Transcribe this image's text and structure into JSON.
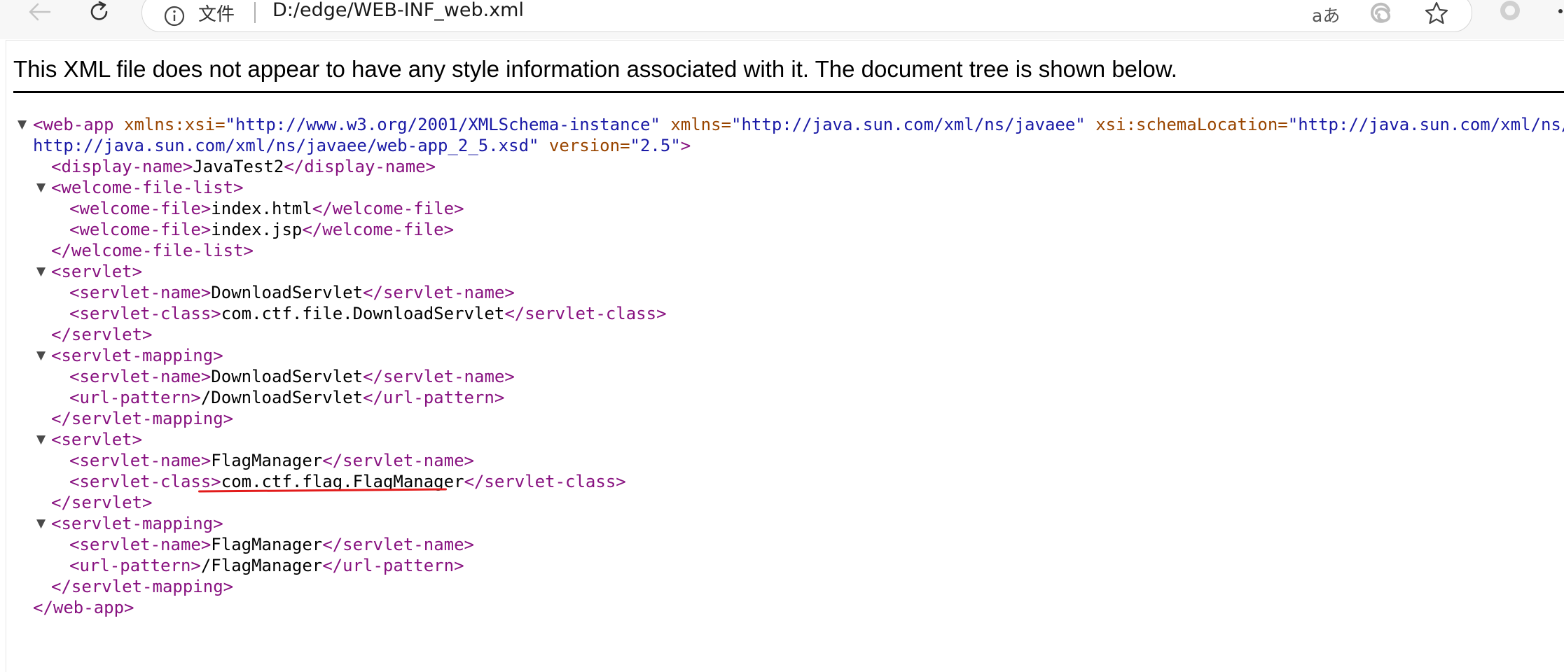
{
  "browser": {
    "address_bar": {
      "site_label": "文件",
      "url": "D:/edge/WEB-INF_web.xml"
    },
    "read_aloud_label": "aあ",
    "icons": {
      "back": "arrow-left-icon",
      "refresh": "refresh-icon",
      "info": "info-icon",
      "read_aloud": "read-aloud-icon",
      "extension": "edge-extension-icon",
      "favorite": "star-icon",
      "profile": "profile-icon",
      "more": "more-icon"
    }
  },
  "notice": "This XML file does not appear to have any style information associated with it. The document tree is shown below.",
  "xml": {
    "root_open": {
      "tag_start": "<web-app",
      "a1_name": " xmlns:xsi=",
      "a1_value": "\"http://www.w3.org/2001/XMLSchema-instance\"",
      "a2_name": " xmlns=",
      "a2_value": "\"http://java.sun.com/xml/ns/javaee\"",
      "a3_name": " xsi:schemaLocation=",
      "a3_value_part1": "\"http://java.sun.com/xml/ns/javaee",
      "a3_value_part2": "http://java.sun.com/xml/ns/javaee/web-app_2_5.xsd\"",
      "a4_name": " version=",
      "a4_value": "\"2.5\"",
      "tag_end": ">"
    },
    "display_name": {
      "open": "<display-name>",
      "text": "JavaTest2",
      "close": "</display-name>"
    },
    "welcome_file_list": {
      "open": "<welcome-file-list>",
      "files": [
        {
          "open": "<welcome-file>",
          "text": "index.html",
          "close": "</welcome-file>"
        },
        {
          "open": "<welcome-file>",
          "text": "index.jsp",
          "close": "</welcome-file>"
        }
      ],
      "close": "</welcome-file-list>"
    },
    "servlet_1": {
      "open": "<servlet>",
      "name": {
        "open": "<servlet-name>",
        "text": "DownloadServlet",
        "close": "</servlet-name>"
      },
      "class": {
        "open": "<servlet-class>",
        "text": "com.ctf.file.DownloadServlet",
        "close": "</servlet-class>"
      },
      "close": "</servlet>"
    },
    "mapping_1": {
      "open": "<servlet-mapping>",
      "name": {
        "open": "<servlet-name>",
        "text": "DownloadServlet",
        "close": "</servlet-name>"
      },
      "pattern": {
        "open": "<url-pattern>",
        "text": "/DownloadServlet",
        "close": "</url-pattern>"
      },
      "close": "</servlet-mapping>"
    },
    "servlet_2": {
      "open": "<servlet>",
      "name": {
        "open": "<servlet-name>",
        "text": "FlagManager",
        "close": "</servlet-name>"
      },
      "class": {
        "open": "<servlet-class>",
        "text": "com.ctf.flag.FlagManager",
        "close": "</servlet-class>"
      },
      "close": "</servlet>"
    },
    "mapping_2": {
      "open": "<servlet-mapping>",
      "name": {
        "open": "<servlet-name>",
        "text": "FlagManager",
        "close": "</servlet-name>"
      },
      "pattern": {
        "open": "<url-pattern>",
        "text": "/FlagManager",
        "close": "</url-pattern>"
      },
      "close": "</servlet-mapping>"
    },
    "root_close": "</web-app>",
    "collapse_arrow": "▼"
  },
  "colors": {
    "tag": "#881280",
    "attribute_name": "#994500",
    "attribute_value": "#1a1aa6",
    "annotation_underline": "#e21b1b"
  }
}
